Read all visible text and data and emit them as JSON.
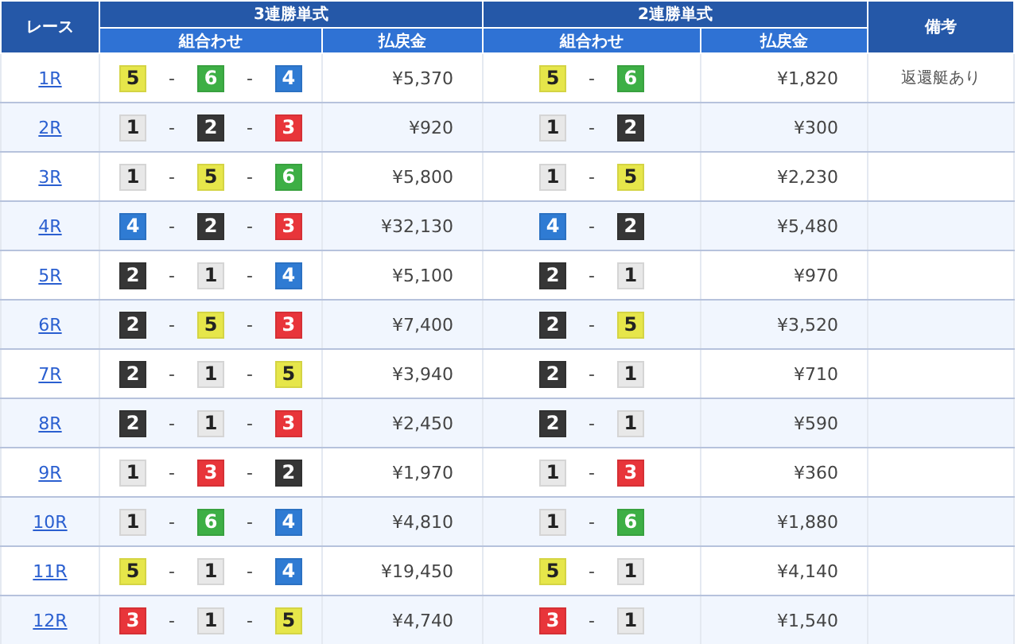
{
  "table": {
    "header_groups": [
      {
        "kind": "race",
        "label": "レース"
      },
      {
        "kind": "group",
        "label": "3連勝単式",
        "columns": [
          "組合わせ",
          "払戻金"
        ]
      },
      {
        "kind": "group",
        "label": "2連勝単式",
        "columns": [
          "組合わせ",
          "払戻金"
        ]
      },
      {
        "kind": "note",
        "label": "備考"
      }
    ],
    "rows": [
      {
        "race": "1R",
        "trifecta": [
          {
            "number": "5",
            "color": "#e6e64a"
          },
          {
            "sep": "-",
            "number": "6",
            "color": "#3daf45"
          },
          {
            "sep": "-",
            "number": "4",
            "color": "#2f7bd3"
          }
        ],
        "trifecta_payout": "¥5,370",
        "exacta": [
          {
            "number": "5",
            "color": "#e6e64a"
          },
          {
            "sep": "-",
            "number": "6",
            "color": "#3daf45"
          }
        ],
        "exacta_payout": "¥1,820",
        "note": "返還艇あり"
      },
      {
        "race": "2R",
        "trifecta": [
          {
            "number": "1",
            "color": "#e8e8e8"
          },
          {
            "sep": "-",
            "number": "2",
            "color": "#363636"
          },
          {
            "sep": "-",
            "number": "3",
            "color": "#e8353a"
          }
        ],
        "trifecta_payout": "¥920",
        "exacta": [
          {
            "number": "1",
            "color": "#e8e8e8"
          },
          {
            "sep": "-",
            "number": "2",
            "color": "#363636"
          }
        ],
        "exacta_payout": "¥300"
      },
      {
        "race": "3R",
        "trifecta": [
          {
            "number": "1",
            "color": "#e8e8e8"
          },
          {
            "sep": "-",
            "number": "5",
            "color": "#e6e64a"
          },
          {
            "sep": "-",
            "number": "6",
            "color": "#3daf45"
          }
        ],
        "trifecta_payout": "¥5,800",
        "exacta": [
          {
            "number": "1",
            "color": "#e8e8e8"
          },
          {
            "sep": "-",
            "number": "5",
            "color": "#e6e64a"
          }
        ],
        "exacta_payout": "¥2,230"
      },
      {
        "race": "4R",
        "trifecta": [
          {
            "number": "4",
            "color": "#2f7bd3"
          },
          {
            "sep": "-",
            "number": "2",
            "color": "#363636"
          },
          {
            "sep": "-",
            "number": "3",
            "color": "#e8353a"
          }
        ],
        "trifecta_payout": "¥32,130",
        "exacta": [
          {
            "number": "4",
            "color": "#2f7bd3"
          },
          {
            "sep": "-",
            "number": "2",
            "color": "#363636"
          }
        ],
        "exacta_payout": "¥5,480"
      },
      {
        "race": "5R",
        "trifecta": [
          {
            "number": "2",
            "color": "#363636"
          },
          {
            "sep": "-",
            "number": "1",
            "color": "#e8e8e8"
          },
          {
            "sep": "-",
            "number": "4",
            "color": "#2f7bd3"
          }
        ],
        "trifecta_payout": "¥5,100",
        "exacta": [
          {
            "number": "2",
            "color": "#363636"
          },
          {
            "sep": "-",
            "number": "1",
            "color": "#e8e8e8"
          }
        ],
        "exacta_payout": "¥970"
      },
      {
        "race": "6R",
        "trifecta": [
          {
            "number": "2",
            "color": "#363636"
          },
          {
            "sep": "-",
            "number": "5",
            "color": "#e6e64a"
          },
          {
            "sep": "-",
            "number": "3",
            "color": "#e8353a"
          }
        ],
        "trifecta_payout": "¥7,400",
        "exacta": [
          {
            "number": "2",
            "color": "#363636"
          },
          {
            "sep": "-",
            "number": "5",
            "color": "#e6e64a"
          }
        ],
        "exacta_payout": "¥3,520"
      },
      {
        "race": "7R",
        "trifecta": [
          {
            "number": "2",
            "color": "#363636"
          },
          {
            "sep": "-",
            "number": "1",
            "color": "#e8e8e8"
          },
          {
            "sep": "-",
            "number": "5",
            "color": "#e6e64a"
          }
        ],
        "trifecta_payout": "¥3,940",
        "exacta": [
          {
            "number": "2",
            "color": "#363636"
          },
          {
            "sep": "-",
            "number": "1",
            "color": "#e8e8e8"
          }
        ],
        "exacta_payout": "¥710"
      },
      {
        "race": "8R",
        "trifecta": [
          {
            "number": "2",
            "color": "#363636"
          },
          {
            "sep": "-",
            "number": "1",
            "color": "#e8e8e8"
          },
          {
            "sep": "-",
            "number": "3",
            "color": "#e8353a"
          }
        ],
        "trifecta_payout": "¥2,450",
        "exacta": [
          {
            "number": "2",
            "color": "#363636"
          },
          {
            "sep": "-",
            "number": "1",
            "color": "#e8e8e8"
          }
        ],
        "exacta_payout": "¥590"
      },
      {
        "race": "9R",
        "trifecta": [
          {
            "number": "1",
            "color": "#e8e8e8"
          },
          {
            "sep": "-",
            "number": "3",
            "color": "#e8353a"
          },
          {
            "sep": "-",
            "number": "2",
            "color": "#363636"
          }
        ],
        "trifecta_payout": "¥1,970",
        "exacta": [
          {
            "number": "1",
            "color": "#e8e8e8"
          },
          {
            "sep": "-",
            "number": "3",
            "color": "#e8353a"
          }
        ],
        "exacta_payout": "¥360"
      },
      {
        "race": "10R",
        "trifecta": [
          {
            "number": "1",
            "color": "#e8e8e8"
          },
          {
            "sep": "-",
            "number": "6",
            "color": "#3daf45"
          },
          {
            "sep": "-",
            "number": "4",
            "color": "#2f7bd3"
          }
        ],
        "trifecta_payout": "¥4,810",
        "exacta": [
          {
            "number": "1",
            "color": "#e8e8e8"
          },
          {
            "sep": "-",
            "number": "6",
            "color": "#3daf45"
          }
        ],
        "exacta_payout": "¥1,880"
      },
      {
        "race": "11R",
        "trifecta": [
          {
            "number": "5",
            "color": "#e6e64a"
          },
          {
            "sep": "-",
            "number": "1",
            "color": "#e8e8e8"
          },
          {
            "sep": "-",
            "number": "4",
            "color": "#2f7bd3"
          }
        ],
        "trifecta_payout": "¥19,450",
        "exacta": [
          {
            "number": "5",
            "color": "#e6e64a"
          },
          {
            "sep": "-",
            "number": "1",
            "color": "#e8e8e8"
          }
        ],
        "exacta_payout": "¥4,140"
      },
      {
        "race": "12R",
        "trifecta": [
          {
            "number": "3",
            "color": "#e8353a"
          },
          {
            "sep": "-",
            "number": "1",
            "color": "#e8e8e8"
          },
          {
            "sep": "-",
            "number": "5",
            "color": "#e6e64a"
          }
        ],
        "trifecta_payout": "¥4,740",
        "exacta": [
          {
            "number": "3",
            "color": "#e8353a"
          },
          {
            "sep": "-",
            "number": "1",
            "color": "#e8e8e8"
          }
        ],
        "exacta_payout": "¥1,540"
      }
    ]
  }
}
